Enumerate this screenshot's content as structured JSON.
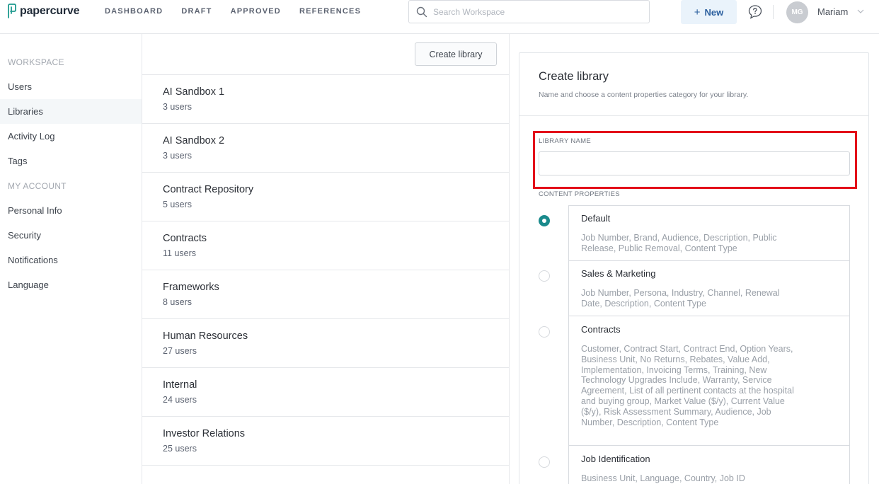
{
  "brand": {
    "name": "papercurve"
  },
  "nav": [
    "DASHBOARD",
    "DRAFT",
    "APPROVED",
    "REFERENCES"
  ],
  "search": {
    "placeholder": "Search Workspace",
    "icon": "search-icon"
  },
  "new_button": {
    "label": "New",
    "icon": "plus-icon"
  },
  "help_icon": "chat-question-icon",
  "user": {
    "initials": "MG",
    "name": "Mariam"
  },
  "sidebar": {
    "items": [
      {
        "label": "WORKSPACE",
        "type": "section"
      },
      {
        "label": "Users",
        "type": "link"
      },
      {
        "label": "Libraries",
        "type": "link",
        "active": true
      },
      {
        "label": "Activity Log",
        "type": "link"
      },
      {
        "label": "Tags",
        "type": "link"
      },
      {
        "label": "MY ACCOUNT",
        "type": "section"
      },
      {
        "label": "Personal Info",
        "type": "link"
      },
      {
        "label": "Security",
        "type": "link"
      },
      {
        "label": "Notifications",
        "type": "link"
      },
      {
        "label": "Language",
        "type": "link"
      }
    ]
  },
  "libraries": {
    "create_button": "Create library",
    "items": [
      {
        "name": "AI Sandbox 1",
        "users": "3 users"
      },
      {
        "name": "AI Sandbox 2",
        "users": "3 users"
      },
      {
        "name": "Contract Repository",
        "users": "5 users"
      },
      {
        "name": "Contracts",
        "users": "11 users"
      },
      {
        "name": "Frameworks",
        "users": "8 users"
      },
      {
        "name": "Human Resources",
        "users": "27 users"
      },
      {
        "name": "Internal",
        "users": "24 users"
      },
      {
        "name": "Investor Relations",
        "users": "25 users"
      }
    ]
  },
  "create_panel": {
    "title": "Create library",
    "subtitle": "Name and choose a content properties category for your library.",
    "name_label": "LIBRARY NAME",
    "name_value": "",
    "properties_label": "CONTENT PROPERTIES",
    "options": [
      {
        "title": "Default",
        "selected": true,
        "desc": "Job Number, Brand, Audience, Description, Public Release, Public Removal, Content Type"
      },
      {
        "title": "Sales & Marketing",
        "selected": false,
        "desc": "Job Number, Persona, Industry, Channel, Renewal Date, Description, Content Type"
      },
      {
        "title": "Contracts",
        "selected": false,
        "desc": "Customer, Contract Start, Contract End, Option Years, Business Unit, No Returns, Rebates, Value Add, Implementation, Invoicing Terms, Training, New Technology Upgrades Include, Warranty, Service Agreement, List of all pertinent contacts at the hospital and buying group, Market Value ($/y), Current Value ($/y), Risk Assessment Summary, Audience, Job Number, Description, Content Type"
      },
      {
        "title": "Job Identification",
        "selected": false,
        "desc": "Business Unit, Language, Country, Job ID"
      }
    ]
  },
  "colors": {
    "accent": "#1a8a8c",
    "highlight": "#e3101a",
    "new_button_bg": "#eaf3fb"
  }
}
